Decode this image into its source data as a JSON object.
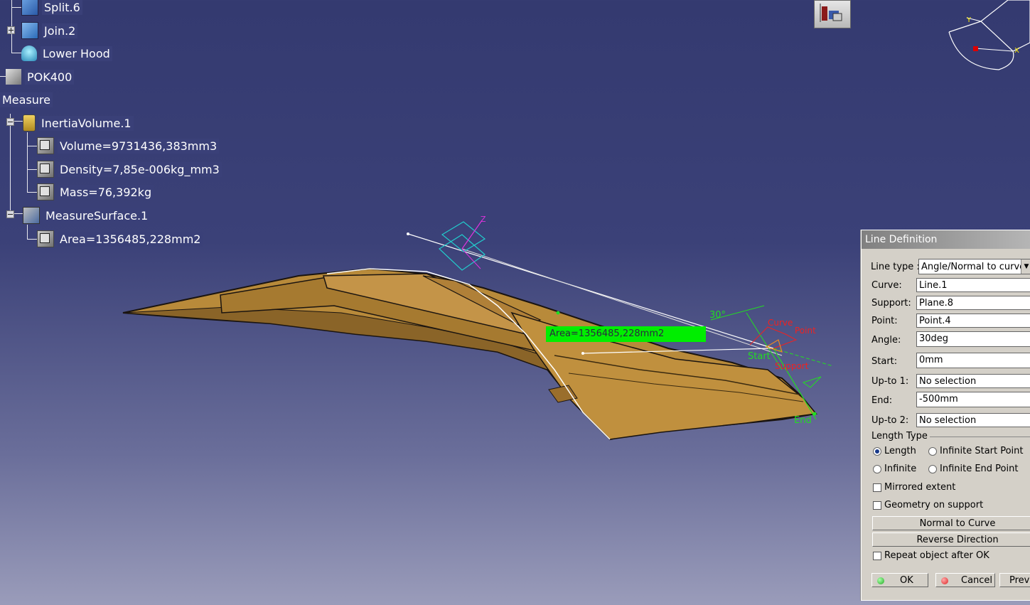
{
  "tree": {
    "split": "Split.6",
    "join": "Join.2",
    "lower_hood": "Lower Hood",
    "part": "POK400",
    "measure": "Measure",
    "inertia": "InertiaVolume.1",
    "volume": "Volume=9731436,383mm3",
    "density": "Density=7,85e-006kg_mm3",
    "mass": "Mass=76,392kg",
    "measure_surface": "MeasureSurface.1",
    "area": "Area=1356485,228mm2"
  },
  "viewport": {
    "area_annotation": "Area=1356485,228mm2",
    "angle_label": "30°",
    "curve_label": "Curve",
    "point_label": "Point",
    "start_label": "Start",
    "support_label": "Support",
    "end_label": "End",
    "z_axis": "Z",
    "compass_y": "Y",
    "compass_x": "X"
  },
  "dialog": {
    "title": "Line Definition",
    "line_type_label": "Line type :",
    "line_type_value": "Angle/Normal to curve",
    "curve_label": "Curve:",
    "curve_value": "Line.1",
    "support_label": "Support:",
    "support_value": "Plane.8",
    "point_label": "Point:",
    "point_value": "Point.4",
    "angle_label": "Angle:",
    "angle_value": "30deg",
    "start_label": "Start:",
    "start_value": "0mm",
    "upto1_label": "Up-to 1:",
    "upto1_value": "No selection",
    "end_label": "End:",
    "end_value": "-500mm",
    "upto2_label": "Up-to 2:",
    "upto2_value": "No selection",
    "length_type_label": "Length Type",
    "opt_length": "Length",
    "opt_infinite_start": "Infinite Start Point",
    "opt_infinite": "Infinite",
    "opt_infinite_end": "Infinite End Point",
    "selected_length_type": "Length",
    "mirrored_extent": "Mirrored extent",
    "geometry_on_support": "Geometry on support",
    "normal_to_curve": "Normal to Curve",
    "reverse_direction": "Reverse Direction",
    "repeat_object": "Repeat object after OK",
    "ok": "OK",
    "cancel": "Cancel",
    "preview": "Previ"
  },
  "colors": {
    "background_top": "#343a70",
    "part_surface": "#b88a3a",
    "annotation_green": "#00ee00",
    "ok_dot": "#22aa22",
    "cancel_dot": "#dd2222"
  }
}
